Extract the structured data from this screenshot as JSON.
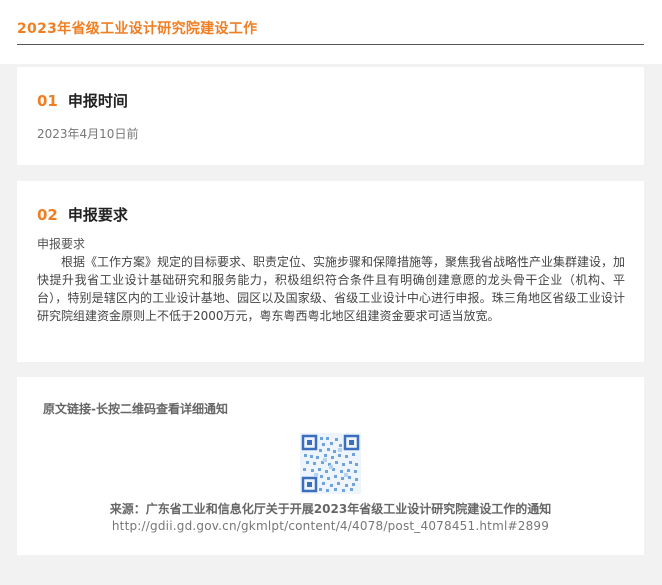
{
  "header": {
    "title": "2023年省级工业设计研究院建设工作"
  },
  "section1": {
    "number": "01",
    "title": "申报时间",
    "content": "2023年4月10日前"
  },
  "section2": {
    "number": "02",
    "title": "申报要求",
    "label": "申报要求",
    "body": "根据《工作方案》规定的目标要求、职责定位、实施步骤和保障措施等，聚焦我省战略性产业集群建设，加快提升我省工业设计基础研究和服务能力，积极组织符合条件且有明确创建意愿的龙头骨干企业（机构、平台），特别是辖区内的工业设计基地、园区以及国家级、省级工业设计中心进行申报。珠三角地区省级工业设计研究院组建资金原则上不低于2000万元，粤东粤西粤北地区组建资金要求可适当放宽。"
  },
  "link_card": {
    "heading": "原文链接-长按二维码查看详细通知",
    "qr_icon": "qr-code-icon",
    "source": "来源：广东省工业和信息化厅关于开展2023年省级工业设计研究院建设工作的通知",
    "url": "http://gdii.gd.gov.cn/gkmlpt/content/4/4078/post_4078451.html#2899"
  },
  "colors": {
    "accent": "#f07f24",
    "background": "#f2f2f2",
    "card": "#ffffff"
  }
}
